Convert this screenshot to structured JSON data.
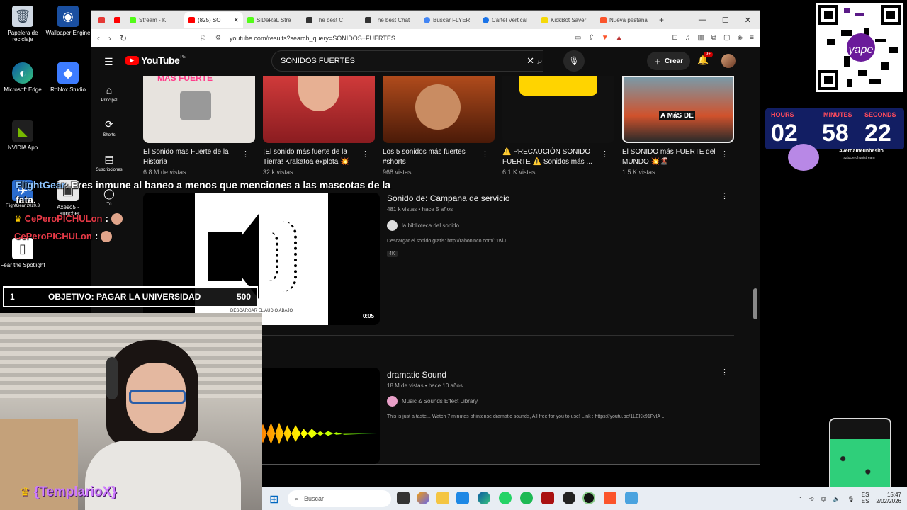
{
  "desktop": {
    "icons": [
      {
        "label": "Papelera de reciclaje",
        "glyph": "🗑"
      },
      {
        "label": "Wallpaper Engine",
        "glyph": "◉"
      },
      {
        "label": "Microsoft Edge",
        "glyph": "◐"
      },
      {
        "label": "Roblox Studio",
        "glyph": "◆"
      },
      {
        "label": "NVIDIA App",
        "glyph": "◣"
      },
      {
        "label": "FlightGear 2020.3",
        "glyph": "✈"
      },
      {
        "label": "Axeso5 - Launcher",
        "glyph": "▣"
      },
      {
        "label": "Fear the Spotlight",
        "glyph": "▯"
      }
    ]
  },
  "browser": {
    "tabs": [
      {
        "label": "",
        "color": "#e53935"
      },
      {
        "label": "Stream - K",
        "color": "#c0183c"
      },
      {
        "label": "(825) SO",
        "color": "#ff0000",
        "active": true
      },
      {
        "label": "SiDeRaL Stre",
        "color": "#53fc18"
      },
      {
        "label": "The best C",
        "color": "#333333"
      },
      {
        "label": "The best Chat",
        "color": "#333333"
      },
      {
        "label": "Buscar FLYER",
        "color": "#4285f4"
      },
      {
        "label": "Cartel Vertical",
        "color": "#1a73e8"
      },
      {
        "label": "KickBot Saver",
        "color": "#f5d90a"
      },
      {
        "label": "Nueva pestaña",
        "color": "#fb542b"
      }
    ],
    "url": "youtube.com/results?search_query=SONIDOS+FUERTES"
  },
  "youtube": {
    "logo_text": "YouTube",
    "logo_region": "PE",
    "search_value": "SONIDOS FUERTES",
    "create_label": "Crear",
    "notif_badge": "9+",
    "sidebar": [
      {
        "label": "Principal",
        "icon": "⌂"
      },
      {
        "label": "Shorts",
        "icon": "⟳"
      },
      {
        "label": "Suscripciones",
        "icon": "▤"
      },
      {
        "label": "Tú",
        "icon": "◯"
      }
    ],
    "shorts": [
      {
        "title": "El Sonido mas Fuerte de la Historia",
        "views": "6.8 M de vistas",
        "thumb_color": "#e7e3de",
        "overlay": "MAS FUERTE"
      },
      {
        "title": "¡El sonido más fuerte de la Tierra! Krakatoa explota 💥",
        "views": "32 k vistas",
        "thumb_color": "#b5282a",
        "overlay": ""
      },
      {
        "title": "Los 5 sonidos más fuertes #shorts",
        "views": "968 vistas",
        "thumb_color": "#8a3a14",
        "overlay": ""
      },
      {
        "title": "⚠️ PRECAUCIÓN SONIDO FUERTE ⚠️ Sonidos más ...",
        "views": "6.1 K vistas",
        "thumb_color": "#111111",
        "overlay": ""
      },
      {
        "title": "El SONIDO más FUERTE del MUNDO 💥🌋",
        "views": "1.5 K vistas",
        "thumb_color": "#6d8a9a",
        "overlay": "A MáS DE"
      }
    ],
    "videos": [
      {
        "title": "Sonido de: Campana de servicio",
        "meta": "481 k vistas • hace 5 años",
        "channel": "la biblioteca del sonido",
        "desc": "Descargar el sonido gratis: http://raboninco.com/11wlJ.",
        "badge": "4K",
        "duration": "0:05",
        "thumb_caption": "DESCARGAR EL AUDIO ABAJO"
      },
      {
        "title": "dramatic Sound",
        "meta": "18 M de vistas • hace 10 años",
        "channel": "Music & Sounds Effect Library",
        "desc": "This is just a taste... Watch 7 minutes of intense dramatic sounds, All free for you to use! Link : https://youtu.be/1LEKk91FvIA ..."
      }
    ]
  },
  "overlay": {
    "chat_message_user": "FlightGear",
    "chat_message_line1": "Eres inmune al baneo a menos que menciones a las mascotas de la",
    "chat_message_line2": "fata.",
    "chat_users": [
      "CePeroPICHULon",
      "CePeroPICHULon"
    ],
    "goal_index": "1",
    "goal_text": "OBJETIVO: PAGAR LA UNIVERSIDAD",
    "goal_amount": "500",
    "webcam_user": "{TemplarioX}"
  },
  "timer": {
    "labels": [
      "HOURS",
      "MINUTES",
      "SECONDS"
    ],
    "hours": "02",
    "minutes": "58",
    "seconds": "22",
    "name": "Averdameunbesito",
    "sub": "Isztucie chupistream"
  },
  "qr": {
    "brand": "yape"
  },
  "taskbar": {
    "search_placeholder": "Buscar",
    "lang_top": "ES",
    "lang_bottom": "ES",
    "time": "15:47",
    "date": "2/02/2026"
  }
}
